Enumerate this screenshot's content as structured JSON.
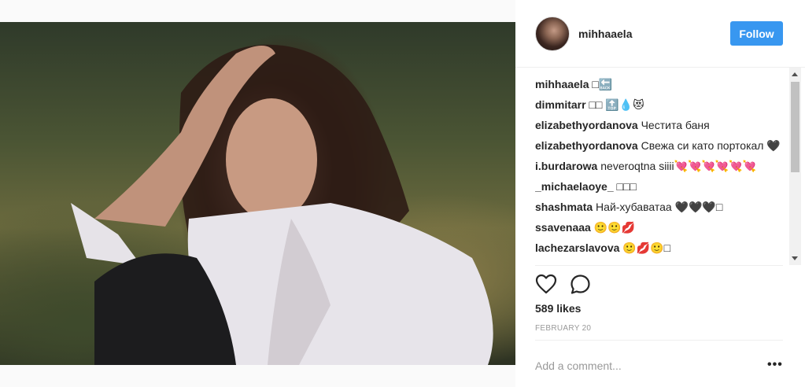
{
  "post": {
    "username": "mihhaaela",
    "follow_label": "Follow",
    "likes": "589 likes",
    "date": "FEBRUARY 20",
    "add_comment_placeholder": "Add a comment...",
    "more_label": "•••"
  },
  "comments": [
    {
      "user": "mihhaaela",
      "text": "□🔙"
    },
    {
      "user": "dimmitarr",
      "text": "□□ 🔝💧😻"
    },
    {
      "user": "elizabethyordanova",
      "text": "Честита баня"
    },
    {
      "user": "elizabethyordanova",
      "text": "Свежа си като портокал 🖤"
    },
    {
      "user": "i.burdarowa",
      "text": "neveroqtna siiii💘💘💘💘💘💘"
    },
    {
      "user": "_michaelaoye_",
      "text": "□□□"
    },
    {
      "user": "shashmata",
      "text": "Най-хубаватаа 🖤🖤🖤□"
    },
    {
      "user": "ssavenaaa",
      "text": "🙂🙂💋"
    },
    {
      "user": "lachezarslavova",
      "text": "🙂💋🙂□"
    }
  ],
  "icons": {
    "like": "heart-icon",
    "comment": "speech-bubble-icon",
    "more": "more-options-icon"
  },
  "colors": {
    "follow_button": "#3897f0",
    "date_text": "#999999",
    "panel_bg": "#ffffff"
  }
}
